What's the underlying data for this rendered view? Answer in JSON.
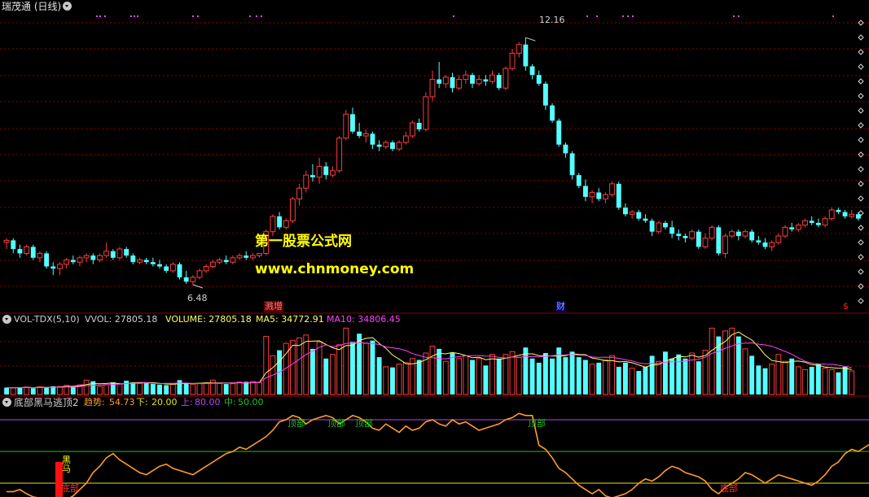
{
  "app": {
    "title": "瑞茂通 (日线)"
  },
  "watermark": {
    "line1": "第一股票公式网",
    "line2": "www.chnmoney.com"
  },
  "price_panel": {
    "high_label": "12.16",
    "low_label": "6.48",
    "events": [
      {
        "label": "溅增",
        "color": "#ff4040"
      },
      {
        "label": "财",
        "color": "#6f8cff"
      },
      {
        "label": "$",
        "color": "#ff2020"
      }
    ]
  },
  "vol_panel": {
    "name": "VOL-TDX(5,10)",
    "vvol_label": "VVOL: 27805.18",
    "volume_label": "VOLUME: 27805.18",
    "ma5_label": "MA5: 34772.91",
    "ma10_label": "MA10: 34806.45"
  },
  "ind_panel": {
    "name": "底部黑马逃顶2",
    "trend_key": "趋势:",
    "trend_val": "54.73",
    "low_key": "下:",
    "low_val": "20.00",
    "up_key": "上:",
    "up_val": "80.00",
    "mid_key": "中:",
    "mid_val": "50.00",
    "top_label": "顶部",
    "bottom_label": "底部",
    "horse_label": "黑马"
  },
  "colors": {
    "up": "#ff3c3c",
    "down": "#54ffff",
    "grid": "#8b0000",
    "ma5": "#ffff60",
    "ma10": "#ff40ff",
    "trend": "#ff9c28",
    "line_up": "#c040ff",
    "line_mid": "#20c020",
    "line_low": "#e0e020"
  },
  "chart_data": {
    "type": "candlestick",
    "ohlc": [
      [
        7.45,
        7.55,
        7.3,
        7.5
      ],
      [
        7.5,
        7.55,
        7.2,
        7.3
      ],
      [
        7.3,
        7.4,
        7.1,
        7.2
      ],
      [
        7.2,
        7.4,
        7.15,
        7.35
      ],
      [
        7.35,
        7.4,
        7.05,
        7.1
      ],
      [
        7.1,
        7.25,
        7.0,
        7.2
      ],
      [
        7.2,
        7.25,
        6.85,
        6.9
      ],
      [
        6.9,
        7.0,
        6.7,
        6.85
      ],
      [
        6.85,
        7.0,
        6.7,
        6.95
      ],
      [
        6.95,
        7.1,
        6.85,
        7.05
      ],
      [
        7.05,
        7.15,
        6.95,
        7.0
      ],
      [
        7.0,
        7.15,
        6.9,
        7.1
      ],
      [
        7.1,
        7.2,
        7.0,
        7.15
      ],
      [
        7.15,
        7.2,
        6.95,
        7.05
      ],
      [
        7.05,
        7.2,
        7.0,
        7.15
      ],
      [
        7.15,
        7.45,
        7.1,
        7.25
      ],
      [
        7.25,
        7.3,
        7.05,
        7.1
      ],
      [
        7.1,
        7.35,
        7.05,
        7.3
      ],
      [
        7.3,
        7.35,
        7.1,
        7.15
      ],
      [
        7.15,
        7.2,
        6.95,
        7.0
      ],
      [
        7.0,
        7.1,
        6.95,
        7.05
      ],
      [
        7.05,
        7.1,
        6.95,
        7.0
      ],
      [
        7.0,
        7.1,
        6.9,
        6.95
      ],
      [
        6.95,
        7.05,
        6.85,
        6.9
      ],
      [
        6.9,
        6.95,
        6.75,
        6.8
      ],
      [
        6.8,
        7.0,
        6.75,
        6.95
      ],
      [
        6.95,
        7.0,
        6.6,
        6.65
      ],
      [
        6.65,
        6.8,
        6.5,
        6.55
      ],
      [
        6.55,
        6.7,
        6.48,
        6.65
      ],
      [
        6.65,
        6.85,
        6.6,
        6.8
      ],
      [
        6.8,
        6.95,
        6.75,
        6.9
      ],
      [
        6.9,
        7.05,
        6.85,
        7.0
      ],
      [
        7.0,
        7.1,
        6.95,
        7.05
      ],
      [
        7.05,
        7.15,
        6.95,
        7.0
      ],
      [
        7.0,
        7.15,
        6.95,
        7.1
      ],
      [
        7.1,
        7.2,
        7.05,
        7.15
      ],
      [
        7.15,
        7.25,
        7.05,
        7.1
      ],
      [
        7.1,
        7.2,
        7.05,
        7.15
      ],
      [
        7.15,
        7.2,
        7.1,
        7.2
      ],
      [
        7.2,
        7.75,
        7.15,
        7.7
      ],
      [
        7.7,
        8.1,
        7.6,
        8.05
      ],
      [
        8.05,
        8.15,
        7.75,
        7.8
      ],
      [
        7.8,
        8.0,
        7.75,
        7.95
      ],
      [
        7.95,
        8.5,
        7.9,
        8.45
      ],
      [
        8.45,
        8.8,
        8.3,
        8.7
      ],
      [
        8.7,
        9.1,
        8.6,
        9.0
      ],
      [
        9.0,
        9.25,
        8.85,
        8.95
      ],
      [
        8.95,
        9.4,
        8.8,
        9.2
      ],
      [
        9.2,
        9.3,
        8.9,
        9.0
      ],
      [
        9.0,
        9.2,
        8.95,
        9.1
      ],
      [
        9.1,
        9.9,
        9.05,
        9.85
      ],
      [
        9.85,
        10.5,
        9.8,
        10.4
      ],
      [
        10.4,
        10.55,
        9.95,
        10.0
      ],
      [
        10.0,
        10.2,
        9.85,
        9.9
      ],
      [
        9.9,
        10.05,
        9.75,
        9.95
      ],
      [
        9.95,
        10.0,
        9.6,
        9.7
      ],
      [
        9.7,
        9.8,
        9.55,
        9.65
      ],
      [
        9.65,
        9.8,
        9.6,
        9.75
      ],
      [
        9.75,
        9.8,
        9.55,
        9.6
      ],
      [
        9.6,
        9.8,
        9.55,
        9.75
      ],
      [
        9.75,
        10.0,
        9.7,
        9.9
      ],
      [
        9.9,
        10.25,
        9.85,
        10.2
      ],
      [
        10.2,
        10.3,
        10.0,
        10.05
      ],
      [
        10.05,
        10.9,
        10.0,
        10.8
      ],
      [
        10.8,
        11.4,
        10.7,
        11.2
      ],
      [
        11.2,
        11.6,
        11.0,
        11.1
      ],
      [
        11.1,
        11.3,
        11.0,
        11.25
      ],
      [
        11.25,
        11.35,
        10.9,
        11.0
      ],
      [
        11.0,
        11.3,
        10.95,
        11.2
      ],
      [
        11.2,
        11.4,
        11.1,
        11.3
      ],
      [
        11.3,
        11.35,
        11.0,
        11.1
      ],
      [
        11.1,
        11.3,
        11.05,
        11.2
      ],
      [
        11.2,
        11.3,
        11.05,
        11.15
      ],
      [
        11.15,
        11.4,
        11.1,
        11.3
      ],
      [
        11.3,
        11.35,
        10.95,
        11.0
      ],
      [
        11.0,
        11.5,
        10.95,
        11.45
      ],
      [
        11.45,
        11.9,
        11.4,
        11.8
      ],
      [
        11.8,
        12.05,
        11.7,
        12.0
      ],
      [
        12.0,
        12.16,
        11.4,
        11.5
      ],
      [
        11.5,
        11.55,
        11.2,
        11.3
      ],
      [
        11.3,
        11.4,
        11.05,
        11.1
      ],
      [
        11.1,
        11.15,
        10.5,
        10.6
      ],
      [
        10.6,
        10.65,
        10.2,
        10.25
      ],
      [
        10.25,
        10.3,
        9.65,
        9.7
      ],
      [
        9.7,
        9.75,
        9.4,
        9.5
      ],
      [
        9.5,
        9.55,
        8.9,
        9.0
      ],
      [
        9.0,
        9.05,
        8.7,
        8.75
      ],
      [
        8.75,
        8.9,
        8.4,
        8.5
      ],
      [
        8.5,
        8.65,
        8.35,
        8.6
      ],
      [
        8.6,
        8.7,
        8.4,
        8.45
      ],
      [
        8.45,
        8.6,
        8.35,
        8.55
      ],
      [
        8.55,
        8.85,
        8.5,
        8.8
      ],
      [
        8.8,
        8.85,
        8.2,
        8.25
      ],
      [
        8.25,
        8.35,
        8.05,
        8.1
      ],
      [
        8.1,
        8.2,
        8.0,
        8.15
      ],
      [
        8.15,
        8.2,
        7.95,
        8.0
      ],
      [
        8.0,
        8.1,
        7.9,
        7.95
      ],
      [
        7.95,
        8.0,
        7.6,
        7.7
      ],
      [
        7.7,
        7.95,
        7.65,
        7.9
      ],
      [
        7.9,
        7.95,
        7.75,
        7.8
      ],
      [
        7.8,
        7.95,
        7.55,
        7.65
      ],
      [
        7.65,
        7.75,
        7.5,
        7.6
      ],
      [
        7.6,
        7.65,
        7.45,
        7.55
      ],
      [
        7.55,
        7.75,
        7.5,
        7.7
      ],
      [
        7.7,
        7.75,
        7.3,
        7.35
      ],
      [
        7.35,
        7.65,
        7.3,
        7.55
      ],
      [
        7.55,
        7.85,
        7.5,
        7.8
      ],
      [
        7.8,
        7.85,
        7.15,
        7.2
      ],
      [
        7.2,
        7.65,
        7.1,
        7.6
      ],
      [
        7.6,
        7.75,
        7.55,
        7.7
      ],
      [
        7.7,
        7.75,
        7.5,
        7.6
      ],
      [
        7.6,
        7.75,
        7.55,
        7.7
      ],
      [
        7.7,
        7.75,
        7.45,
        7.5
      ],
      [
        7.5,
        7.6,
        7.4,
        7.45
      ],
      [
        7.45,
        7.55,
        7.3,
        7.35
      ],
      [
        7.35,
        7.5,
        7.25,
        7.45
      ],
      [
        7.45,
        7.65,
        7.4,
        7.6
      ],
      [
        7.6,
        7.85,
        7.55,
        7.8
      ],
      [
        7.8,
        7.9,
        7.7,
        7.75
      ],
      [
        7.75,
        7.9,
        7.7,
        7.85
      ],
      [
        7.85,
        8.0,
        7.8,
        7.95
      ],
      [
        7.95,
        8.05,
        7.85,
        7.9
      ],
      [
        7.9,
        8.0,
        7.8,
        7.85
      ],
      [
        7.85,
        8.05,
        7.8,
        8.0
      ],
      [
        8.0,
        8.25,
        7.95,
        8.2
      ],
      [
        8.2,
        8.25,
        8.1,
        8.15
      ],
      [
        8.15,
        8.2,
        8.0,
        8.05
      ],
      [
        8.05,
        8.2,
        8.0,
        8.1
      ],
      [
        8.1,
        8.15,
        7.95,
        8.0
      ]
    ],
    "volume": [
      2500,
      2400,
      2600,
      2700,
      2300,
      2800,
      2600,
      3000,
      2900,
      3300,
      3100,
      3500,
      5200,
      4800,
      2900,
      3600,
      4400,
      3800,
      5000,
      4400,
      4000,
      4300,
      3800,
      3600,
      3400,
      3700,
      5200,
      4000,
      3700,
      3900,
      4200,
      5200,
      4000,
      3800,
      3900,
      4500,
      4600,
      4700,
      4300,
      21000,
      14000,
      16000,
      18500,
      19500,
      20500,
      21500,
      16500,
      19000,
      13000,
      14500,
      18000,
      24000,
      19000,
      22000,
      18500,
      19500,
      13500,
      10000,
      9800,
      11000,
      11500,
      13000,
      12500,
      15000,
      17500,
      16500,
      12000,
      15000,
      13000,
      14000,
      12500,
      13000,
      10500,
      14500,
      13000,
      14500,
      15500,
      13500,
      17000,
      13000,
      11500,
      15000,
      13000,
      17000,
      13500,
      15500,
      13500,
      12500,
      11000,
      11500,
      12500,
      14000,
      10000,
      11500,
      9500,
      8500,
      10000,
      14000,
      12000,
      15500,
      13000,
      14500,
      13000,
      15000,
      12000,
      16000,
      24000,
      21000,
      23000,
      24000,
      21000,
      16500,
      14000,
      10500,
      9500,
      11000,
      14500,
      12000,
      13000,
      10000,
      9000,
      10000,
      11000,
      9500,
      9000,
      8000,
      10000,
      8500
    ],
    "vol_color": [
      "down",
      "up",
      "down",
      "up",
      "down",
      "up",
      "down",
      "down",
      "up",
      "up",
      "down",
      "up",
      "up",
      "down",
      "up",
      "up",
      "down",
      "up",
      "down",
      "down",
      "up",
      "down",
      "down",
      "down",
      "down",
      "up",
      "down",
      "down",
      "up",
      "up",
      "up",
      "up",
      "up",
      "down",
      "up",
      "up",
      "down",
      "up",
      "up",
      "up",
      "up",
      "down",
      "up",
      "up",
      "up",
      "up",
      "down",
      "up",
      "down",
      "up",
      "up",
      "up",
      "down",
      "down",
      "up",
      "down",
      "down",
      "up",
      "down",
      "up",
      "up",
      "up",
      "down",
      "up",
      "up",
      "down",
      "up",
      "down",
      "up",
      "up",
      "down",
      "up",
      "down",
      "up",
      "down",
      "up",
      "up",
      "up",
      "down",
      "down",
      "down",
      "down",
      "down",
      "down",
      "down",
      "down",
      "down",
      "down",
      "up",
      "down",
      "up",
      "up",
      "down",
      "down",
      "up",
      "down",
      "down",
      "down",
      "up",
      "down",
      "down",
      "down",
      "down",
      "up",
      "down",
      "up",
      "up",
      "down",
      "up",
      "up",
      "down",
      "up",
      "down",
      "down",
      "down",
      "up",
      "up",
      "up",
      "down",
      "up",
      "up",
      "down",
      "down",
      "up",
      "up",
      "down",
      "down",
      "up",
      "down"
    ],
    "trend": [
      12,
      12,
      14,
      10,
      7,
      6,
      4,
      3,
      2,
      4,
      8,
      14,
      20,
      30,
      36,
      44,
      48,
      42,
      38,
      34,
      30,
      28,
      32,
      36,
      38,
      34,
      32,
      30,
      28,
      32,
      36,
      40,
      44,
      48,
      50,
      54,
      52,
      56,
      60,
      64,
      70,
      78,
      80,
      84,
      82,
      76,
      80,
      82,
      84,
      82,
      76,
      80,
      84,
      82,
      78,
      72,
      70,
      76,
      72,
      68,
      74,
      70,
      72,
      78,
      80,
      76,
      74,
      80,
      76,
      78,
      74,
      70,
      72,
      74,
      76,
      80,
      82,
      86,
      84,
      84,
      56,
      52,
      44,
      34,
      30,
      24,
      18,
      14,
      10,
      14,
      8,
      6,
      8,
      10,
      14,
      20,
      24,
      22,
      26,
      32,
      36,
      34,
      30,
      28,
      26,
      22,
      14,
      10,
      16,
      20,
      24,
      30,
      28,
      24,
      20,
      24,
      28,
      26,
      24,
      22,
      20,
      18,
      22,
      28,
      36,
      40,
      48,
      52,
      50,
      54,
      58,
      56,
      52,
      54,
      50,
      48
    ],
    "price_range": [
      6.2,
      12.5
    ],
    "volume_range": [
      0,
      25000
    ],
    "indicator_range": [
      0,
      100
    ],
    "indicator_levels": {
      "up": 80,
      "mid": 50,
      "low": 20
    }
  }
}
